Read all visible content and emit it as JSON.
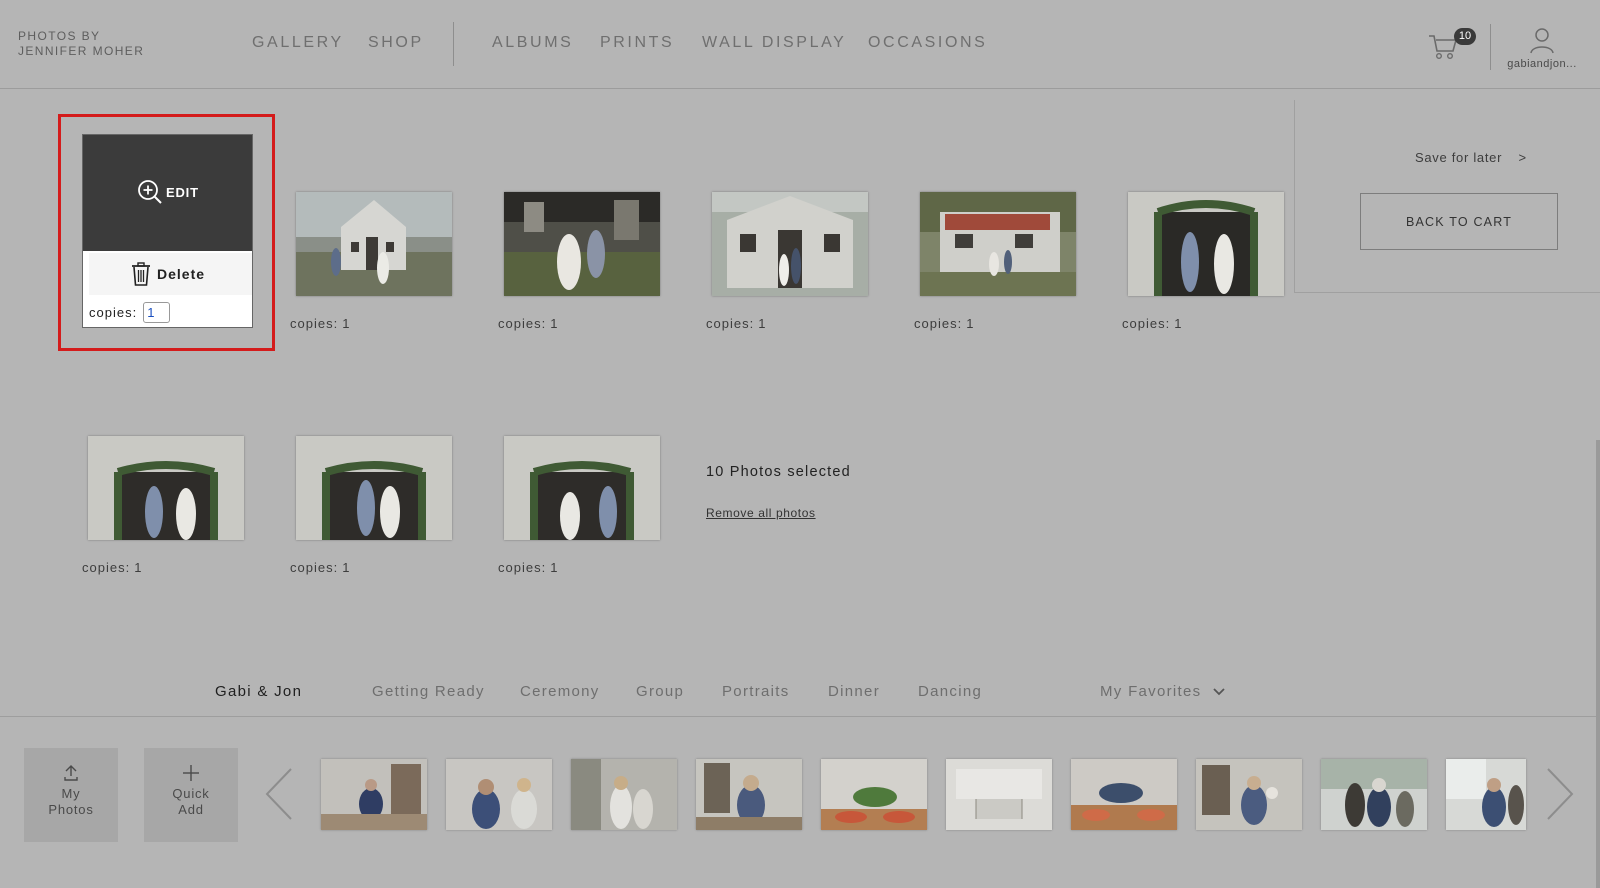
{
  "brand": {
    "line1": "PHOTOS BY",
    "line2": "JENNIFER MOHER"
  },
  "nav": [
    {
      "label": "GALLERY"
    },
    {
      "label": "SHOP"
    },
    {
      "label": "ALBUMS"
    },
    {
      "label": "PRINTS"
    },
    {
      "label": "WALL DISPLAY"
    },
    {
      "label": "OCCASIONS"
    }
  ],
  "cart": {
    "count": "10",
    "icon": "cart-icon"
  },
  "user": {
    "name": "gabiandjon...",
    "icon": "user-icon"
  },
  "side_panel": {
    "save_later": "Save for later",
    "save_later_arrow": ">",
    "back_to_cart": "BACK TO CART"
  },
  "active_photo": {
    "edit_label": "EDIT",
    "delete_label": "Delete",
    "copies_label": "copies:",
    "copies_value": "1"
  },
  "photos": [
    {
      "copies_label": "copies:",
      "copies": "1"
    },
    {
      "copies_label": "copies:",
      "copies": "1"
    },
    {
      "copies_label": "copies:",
      "copies": "1"
    },
    {
      "copies_label": "copies:",
      "copies": "1"
    },
    {
      "copies_label": "copies:",
      "copies": "1"
    },
    {
      "copies_label": "copies:",
      "copies": "1"
    },
    {
      "copies_label": "copies:",
      "copies": "1"
    },
    {
      "copies_label": "copies:",
      "copies": "1"
    }
  ],
  "selection": {
    "count_text": "10 Photos selected",
    "remove_all": "Remove all photos"
  },
  "album_tabs": [
    {
      "label": "Gabi & Jon"
    },
    {
      "label": "Getting Ready"
    },
    {
      "label": "Ceremony"
    },
    {
      "label": "Group"
    },
    {
      "label": "Portraits"
    },
    {
      "label": "Dinner"
    },
    {
      "label": "Dancing"
    }
  ],
  "favorites": {
    "label": "My Favorites"
  },
  "tools": {
    "my_photos_1": "My",
    "my_photos_2": "Photos",
    "quick_add_1": "Quick",
    "quick_add_2": "Add"
  },
  "colors": {
    "background": "#b5b5b5",
    "highlight": "#d41b1b",
    "dark_pane": "#3b3b3b"
  }
}
